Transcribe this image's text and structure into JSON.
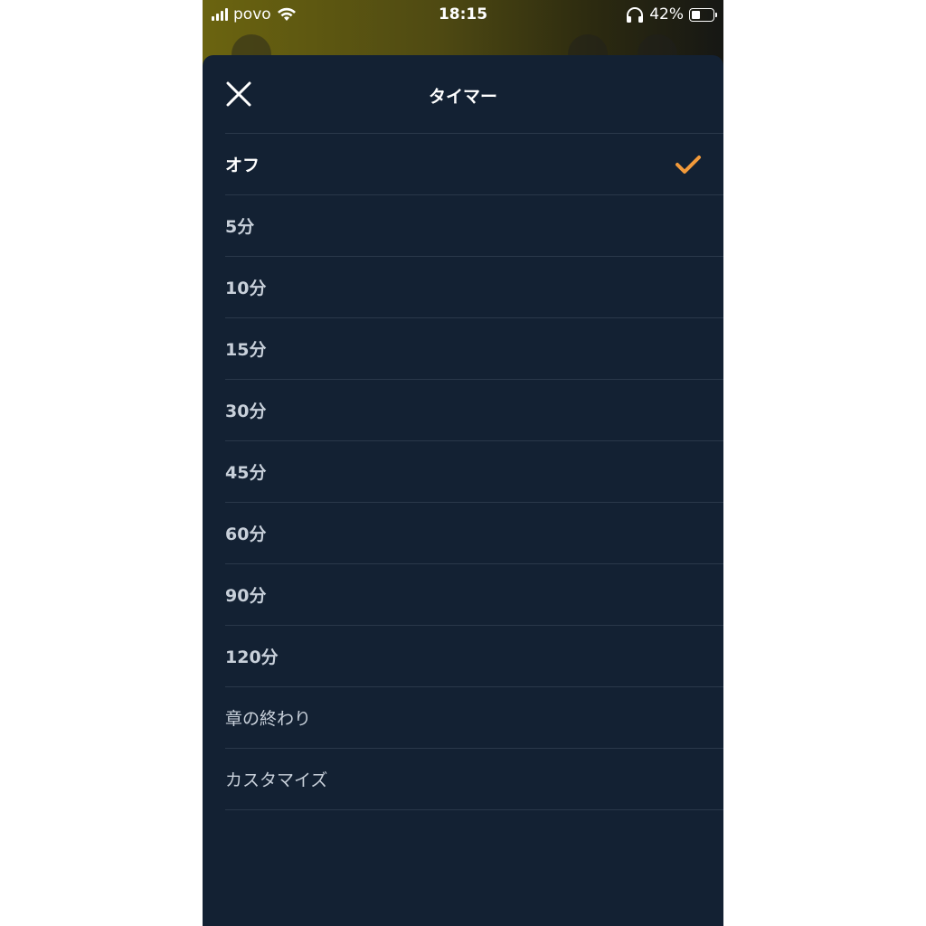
{
  "status_bar": {
    "carrier": "povo",
    "time": "18:15",
    "battery_percent": "42%",
    "battery_level": 0.42
  },
  "sheet": {
    "title": "タイマー",
    "close_icon": "close-icon",
    "selected_icon": "checkmark-icon",
    "accent_color": "#f29a3a",
    "background_color": "#132133"
  },
  "options": [
    {
      "label": "オフ",
      "selected": true
    },
    {
      "label": "5分",
      "selected": false
    },
    {
      "label": "10分",
      "selected": false
    },
    {
      "label": "15分",
      "selected": false
    },
    {
      "label": "30分",
      "selected": false
    },
    {
      "label": "45分",
      "selected": false
    },
    {
      "label": "60分",
      "selected": false
    },
    {
      "label": "90分",
      "selected": false
    },
    {
      "label": "120分",
      "selected": false
    },
    {
      "label": "章の終わり",
      "selected": false
    },
    {
      "label": "カスタマイズ",
      "selected": false
    }
  ]
}
